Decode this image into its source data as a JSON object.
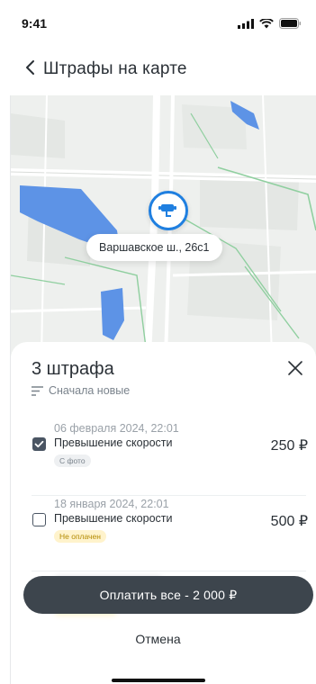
{
  "status_bar": {
    "time": "9:41"
  },
  "header": {
    "title": "Штрафы на карте"
  },
  "map": {
    "address_label": "Варшавское ш., 26с1"
  },
  "sheet": {
    "count_title": "3 штрафа",
    "sort_label": "Сначала новые",
    "fines": [
      {
        "date": "06 февраля 2024, 22:01",
        "description": "Превышение скорости",
        "badge": "С фото",
        "price": "250 ₽",
        "checked": true
      },
      {
        "date": "18 января 2024, 22:01",
        "description": "Превышение скорости",
        "badge": "Не оплачен",
        "price": "500 ₽",
        "checked": false
      }
    ],
    "pay_button": "Оплатить все - 2 000 ₽",
    "cancel_button": "Отмена"
  },
  "colors": {
    "accent": "#1f7fe0",
    "primary_button": "#3d454d"
  }
}
